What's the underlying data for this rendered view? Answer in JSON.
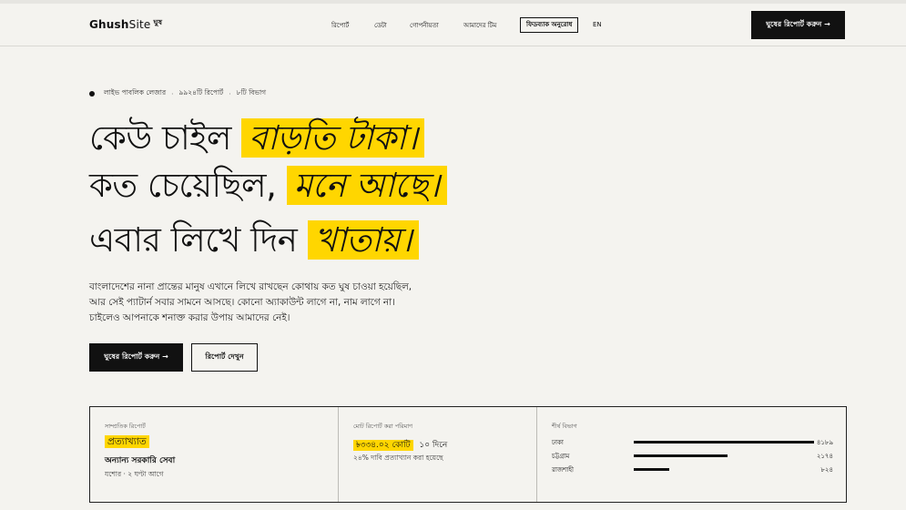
{
  "header": {
    "brand_bold": "Ghush",
    "brand_light": "Site",
    "brand_mark": "ঘুষ",
    "nav": [
      "রিপোর্ট",
      "ডেটা",
      "গোপনীয়তা",
      "আমাদের টিম"
    ],
    "feedback_label": "ফিডব্যাক অনুরোধ",
    "lang": "EN",
    "cta": "ঘুষের রিপোর্ট করুন →"
  },
  "ticker": {
    "live": "লাইভ পাবলিক লেজার",
    "reports": "৯৯২৪টি রিপোর্ট",
    "departments": "৮টি বিভাগ"
  },
  "headline": {
    "l1_plain": "কেউ চাইল",
    "l1_highlight": "বাড়তি টাকা।",
    "l2_plain": "কত চেয়েছিল,",
    "l2_highlight": "মনে আছে।",
    "l3_plain": "এবার লিখে দিন",
    "l3_highlight": "খাতায়।"
  },
  "lede": [
    "বাংলাদেশের নানা প্রান্তের মানুষ এখানে লিখে রাখছেন কোথায় কত ঘুষ চাওয়া হয়েছিল,",
    "আর সেই প্যাটার্ন সবার সামনে আসছে। কোনো অ্যাকাউন্ট লাগে না, নাম লাগে না।",
    "চাইলেও আপনাকে শনাক্ত করার উপায় আমাদের নেই।"
  ],
  "buttons": {
    "report": "ঘুষের রিপোর্ট করুন →",
    "view": "রিপোর্ট দেখুন"
  },
  "stats": {
    "recent": {
      "caption": "সাম্প্রতিক রিপোর্ট",
      "status": "প্রত্যাখ্যাত",
      "title": "অন্যান্য সরকারি সেবা",
      "meta": "যশোর · ২ ঘণ্টা আগে"
    },
    "total": {
      "caption": "মোট রিপোর্ট করা পরিমাণ",
      "amount": "৳৩৩৪.০২ কোটি",
      "period": "১০ দিনে",
      "note": "২৪% দাবি প্রত্যাখ্যান করা হয়েছে"
    },
    "top": {
      "caption": "শীর্ষ বিভাগ",
      "rows": [
        {
          "name": "ঢাকা",
          "value": "৪১৮৯",
          "share": 1.0
        },
        {
          "name": "চট্টগ্রাম",
          "value": "২১৭৪",
          "share": 0.52
        },
        {
          "name": "রাজশাহী",
          "value": "৮২৪",
          "share": 0.197
        }
      ]
    }
  }
}
